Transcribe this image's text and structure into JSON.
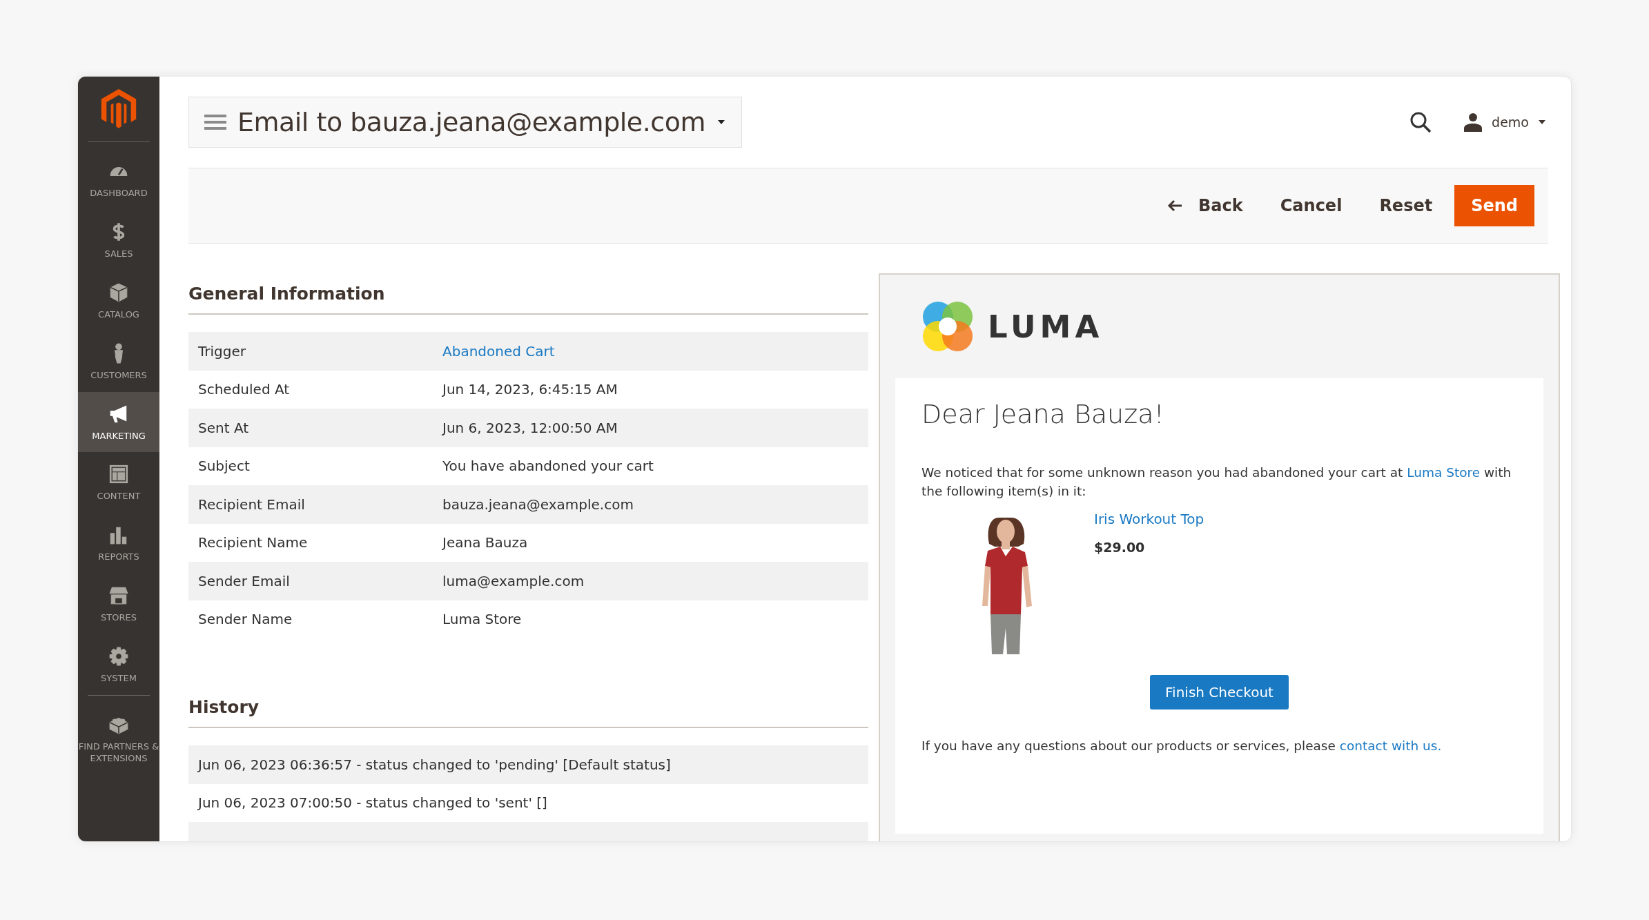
{
  "sidebar": {
    "items": [
      {
        "label": "DASHBOARD",
        "selected": false
      },
      {
        "label": "SALES",
        "selected": false
      },
      {
        "label": "CATALOG",
        "selected": false
      },
      {
        "label": "CUSTOMERS",
        "selected": false
      },
      {
        "label": "MARKETING",
        "selected": true
      },
      {
        "label": "CONTENT",
        "selected": false
      },
      {
        "label": "REPORTS",
        "selected": false
      },
      {
        "label": "STORES",
        "selected": false
      },
      {
        "label": "SYSTEM",
        "selected": false
      },
      {
        "label": "FIND PARTNERS & EXTENSIONS",
        "selected": false
      }
    ]
  },
  "header": {
    "title": "Email to bauza.jeana@example.com",
    "user": "demo"
  },
  "actions": [
    {
      "label": "Back",
      "kind": "back"
    },
    {
      "label": "Cancel",
      "kind": "plain"
    },
    {
      "label": "Reset",
      "kind": "plain"
    },
    {
      "label": "Send",
      "kind": "primary"
    }
  ],
  "general_information": {
    "heading": "General Information",
    "rows": [
      {
        "label": "Trigger",
        "value": "Abandoned Cart",
        "kind": "link"
      },
      {
        "label": "Scheduled At",
        "value": "Jun 14, 2023, 6:45:15 AM",
        "kind": "text"
      },
      {
        "label": "Sent At",
        "value": "Jun 6, 2023, 12:00:50 AM",
        "kind": "text"
      },
      {
        "label": "Subject",
        "value": "You have abandoned your cart",
        "kind": "text"
      },
      {
        "label": "Recipient Email",
        "value": "bauza.jeana@example.com",
        "kind": "text"
      },
      {
        "label": "Recipient Name",
        "value": "Jeana Bauza",
        "kind": "text"
      },
      {
        "label": "Sender Email",
        "value": "luma@example.com",
        "kind": "text"
      },
      {
        "label": "Sender Name",
        "value": "Luma Store",
        "kind": "text"
      }
    ]
  },
  "history": {
    "heading": "History",
    "entries": [
      "Jun 06, 2023 06:36:57 - status changed to 'pending' [Default status]",
      "Jun 06, 2023 07:00:50 - status changed to 'sent' []"
    ]
  },
  "email_preview": {
    "brand": "LUMA",
    "greeting": "Dear Jeana Bauza!",
    "intro": "We noticed that for some unknown reason you had abandoned your cart at ",
    "store_link": "Luma Store",
    "intro_end": " with the following item(s) in it:",
    "product": {
      "name": "Iris Workout Top",
      "price": "$29.00"
    },
    "button": "Finish Checkout",
    "footer": "If you have any questions about our products or services, please ",
    "footer_link": "contact with us."
  }
}
